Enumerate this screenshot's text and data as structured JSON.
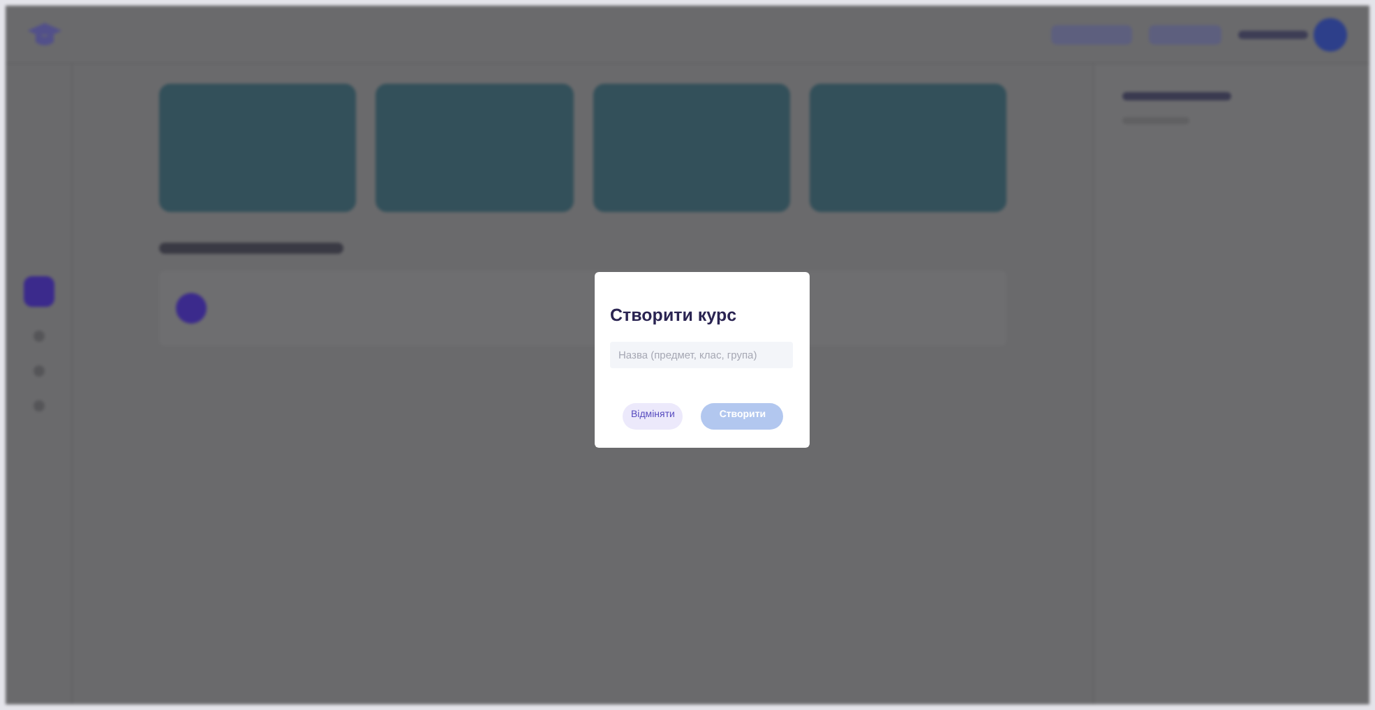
{
  "sidebar": {
    "items": [
      {
        "selected": true
      },
      {
        "selected": false
      },
      {
        "selected": false
      },
      {
        "selected": false
      }
    ]
  },
  "dialog": {
    "title": "Створити курс",
    "name_field": {
      "placeholder": "Назва (предмет, клас, група)"
    },
    "buttons": [
      {
        "kind": "secondary",
        "label": "Відміняти"
      },
      {
        "kind": "primary",
        "label": "Створити"
      }
    ]
  }
}
